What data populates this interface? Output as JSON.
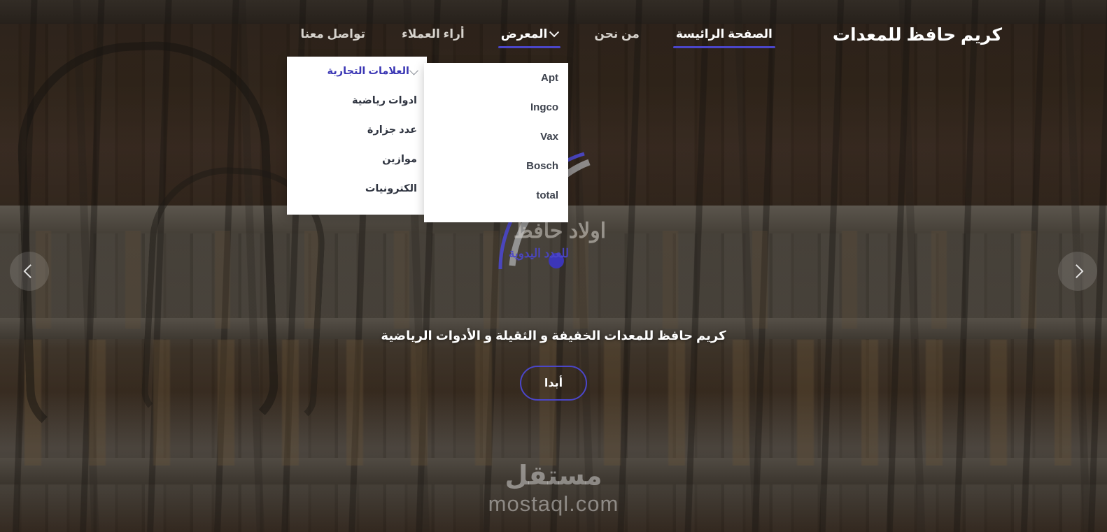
{
  "site": {
    "brand_title": "كريم حافظ للمعدات",
    "accent_color": "#4b46c9",
    "menu_active_color": "#3a36b4",
    "panel_bg": "#ffffff"
  },
  "nav": {
    "items": [
      {
        "label": "الصفحة الرائيسة",
        "name": "nav-home",
        "active": true,
        "has_chevron": false
      },
      {
        "label": "من نحن",
        "name": "nav-about",
        "active": false,
        "has_chevron": false
      },
      {
        "label": "المعرض",
        "name": "nav-gallery",
        "active": false,
        "open": true,
        "has_chevron": true,
        "chevron_icon": "chevron-down-icon"
      },
      {
        "label": "أراء العملاء",
        "name": "nav-testimonials",
        "active": false,
        "has_chevron": false
      },
      {
        "label": "تواصل معنا",
        "name": "nav-contact",
        "active": false,
        "has_chevron": false
      }
    ]
  },
  "dropdown": {
    "categories": [
      {
        "label": "العلامات التجارية",
        "active": true,
        "has_submenu": true,
        "submenu_icon": "chevron-down-icon"
      },
      {
        "label": "ادوات رياضية",
        "active": false,
        "has_submenu": false
      },
      {
        "label": "عدد جزارة",
        "active": false,
        "has_submenu": false
      },
      {
        "label": "موازين",
        "active": false,
        "has_submenu": false
      },
      {
        "label": "الكترونيات",
        "active": false,
        "has_submenu": false
      }
    ],
    "brands": [
      {
        "label": "Apt"
      },
      {
        "label": "Ingco"
      },
      {
        "label": "Vax"
      },
      {
        "label": "Bosch"
      },
      {
        "label": "total"
      }
    ]
  },
  "hero": {
    "tagline": "كريم حافظ للمعدات الخفيفة و الثقيلة و الأدوات الرياضية",
    "cta_label": "أبدا",
    "prev_icon": "chevron-left-icon",
    "next_icon": "chevron-right-icon",
    "logo_line_1": "اولاد حافظ",
    "logo_line_2": "للعدد اليدوية"
  },
  "watermark": {
    "arabic": "مستقل",
    "latin": "mostaql.com"
  }
}
